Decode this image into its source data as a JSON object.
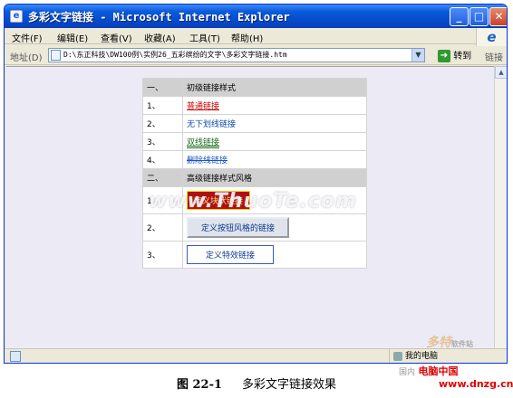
{
  "window": {
    "icon_glyph": "e",
    "title": "多彩文字链接 - Microsoft Internet Explorer",
    "buttons": {
      "minimize": "_",
      "maximize": "□",
      "close": "✕"
    }
  },
  "menu": [
    {
      "label": "文件(F)"
    },
    {
      "label": "编辑(E)"
    },
    {
      "label": "查看(V)"
    },
    {
      "label": "收藏(A)"
    },
    {
      "label": "工具(T)"
    },
    {
      "label": "帮助(H)"
    }
  ],
  "ie_logo_glyph": "e",
  "address": {
    "label": "地址(D)",
    "value": "D:\\东正科技\\DW100例\\实例26_五彩缤纷的文字\\多彩文字链接.htm",
    "go_label": "转到",
    "links_label": "链接"
  },
  "table": {
    "section1": {
      "num": "一、",
      "title": "初级链接样式"
    },
    "rows1": [
      {
        "num": "1、",
        "text": "普通链接"
      },
      {
        "num": "2、",
        "text": "无下划线链接"
      },
      {
        "num": "3、",
        "text": "双线链接"
      },
      {
        "num": "4、",
        "text": "删除线链接"
      }
    ],
    "section2": {
      "num": "二、",
      "title": "高级链接样式风格"
    },
    "rows2": [
      {
        "num": "1、",
        "text": "定义块状链接"
      },
      {
        "num": "2、",
        "text": "定义按钮风格的链接"
      },
      {
        "num": "3、",
        "text": "定义特效链接"
      }
    ]
  },
  "status": {
    "zone": "我的电脑"
  },
  "overlays": {
    "watermark": "www.ThuoTe.com",
    "corner_logo": "多特",
    "corner_logo_sub": "软件站"
  },
  "caption": {
    "figure": "图 22-1",
    "text": "多彩文字链接效果"
  },
  "stamp": {
    "brand": "电脑中国",
    "gov": "国内",
    "url": "www.dnzg.cn"
  }
}
